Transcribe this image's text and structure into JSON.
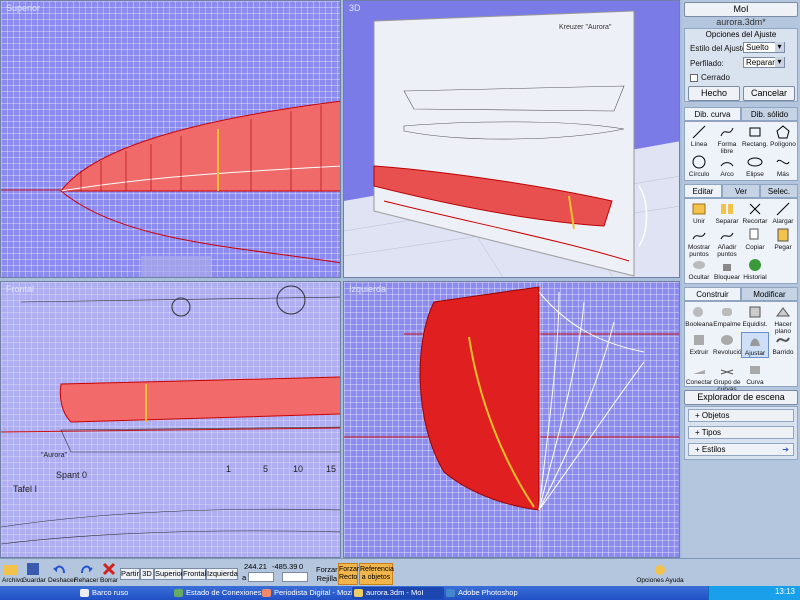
{
  "window": {
    "title": "aurora.3dm*",
    "app_button": "MoI"
  },
  "viewports": [
    {
      "id": "top",
      "label": "Superior"
    },
    {
      "id": "3d",
      "label": "3D"
    },
    {
      "id": "front",
      "label": "Frontal"
    },
    {
      "id": "left",
      "label": "Izquierda"
    }
  ],
  "front_texts": {
    "aurora": "\"Aurora\"",
    "spant": "Spant 0",
    "tafel": "Tafel I",
    "scale": [
      "1",
      "5",
      "10",
      "15"
    ]
  },
  "blueprint_title": "Kreuzer \"Aurora\"",
  "fit_panel": {
    "title": "Opciones del Ajuste",
    "style_label": "Estilo del Ajuste:",
    "style_value": "Suelto",
    "profile_label": "Perfilado:",
    "profile_value": "Reparar",
    "closed_label": "Cerrado",
    "done": "Hecho",
    "cancel": "Cancelar"
  },
  "draw_tabs": [
    "Dib. curva",
    "Dib. sólido"
  ],
  "draw_tools": [
    "Línea",
    "Forma libre",
    "Rectang.",
    "Polígono",
    "Círculo",
    "Arco",
    "Elipse",
    "Más"
  ],
  "edit_tabs": [
    "Editar",
    "Ver",
    "Selec."
  ],
  "edit_tools": [
    "Unir",
    "Separar",
    "Recortar",
    "Alargar",
    "Mostrar puntos",
    "Añadir puntos",
    "Copiar",
    "Pegar",
    "Ocultar",
    "Bloquear",
    "Historial"
  ],
  "build_tabs": [
    "Construir",
    "Modificar"
  ],
  "build_tools": [
    "Booleana",
    "Empalme",
    "Equidist.",
    "Hacer plano",
    "Extruir",
    "Revolución",
    "Ajustar",
    "Barrido",
    "Conectar",
    "Grupo de curvas",
    "Curva"
  ],
  "explorer": {
    "title": "Explorador de escena",
    "items": [
      "Objetos",
      "Tipos",
      "Estilos"
    ]
  },
  "bottom": {
    "file": [
      "Archivo",
      "Guardar"
    ],
    "undo": [
      "Deshacer",
      "Rehacer"
    ],
    "delete": "Borrar",
    "views": [
      "Partir",
      "3D",
      "Superior",
      "Frontal",
      "Izquierda"
    ],
    "coord_x": "244.21",
    "coord_y": "-485.39",
    "coord_z": "0",
    "a_label": "a",
    "snap": [
      "Forzar",
      "Rejilla"
    ],
    "snap_on": [
      "Forzar",
      "Recto"
    ],
    "ref": [
      "Referencia",
      "a objetos"
    ],
    "options": [
      "Opciones",
      "Ayuda"
    ]
  },
  "taskbar": {
    "items": [
      "Barco ruso",
      "Estado de Conexiones ...",
      "Periodista Digital - Mozill...",
      "aurora.3dm - MoI",
      "Adobe Photoshop"
    ],
    "clock": "13:13"
  },
  "colors": {
    "accent": "#e8c44a",
    "hull_red": "#e02020",
    "grid_blue": "#8c8cf0"
  }
}
